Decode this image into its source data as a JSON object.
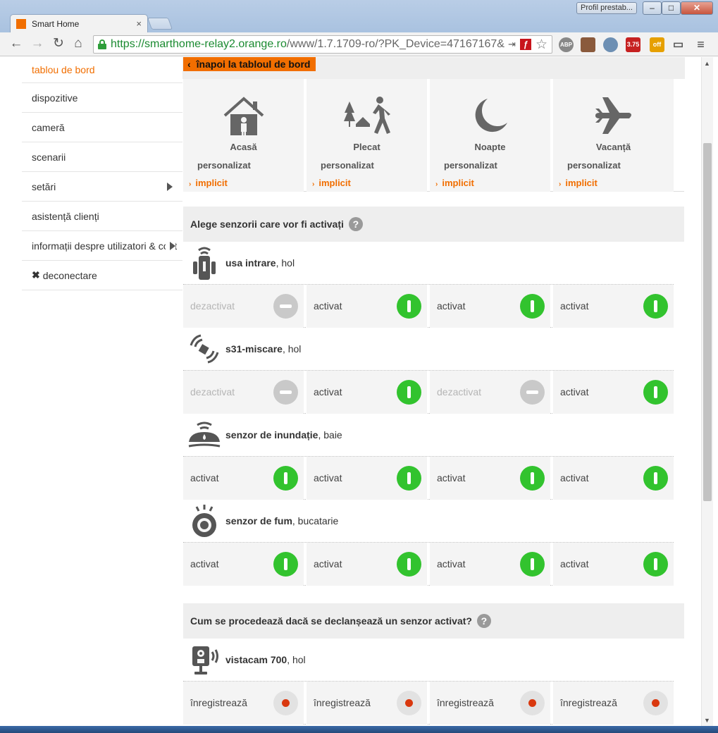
{
  "browser": {
    "tab_title": "Smart Home",
    "tab_close": "×",
    "profile_label": "Profil prestab...",
    "url_scheme_host": "https://smarthome-relay2.orange.ro",
    "url_rest": "/www/1.7.1709-ro/?PK_Device=47167167&",
    "ext_badge_a": "ABP",
    "ext_badge_b": "3.75",
    "ext_badge_c": "off"
  },
  "sidebar": {
    "items": [
      {
        "label": "tablou de bord"
      },
      {
        "label": "dispozitive"
      },
      {
        "label": "cameră"
      },
      {
        "label": "scenarii"
      },
      {
        "label": "setări"
      },
      {
        "label": "asistență clienți"
      },
      {
        "label": "informații despre utilizatori & cont"
      },
      {
        "label": "deconectare"
      }
    ]
  },
  "main": {
    "back_label": "înapoi la tabloul de bord",
    "modes": [
      {
        "name": "Acasă",
        "custom": "personalizat",
        "default": "implicit"
      },
      {
        "name": "Plecat",
        "custom": "personalizat",
        "default": "implicit"
      },
      {
        "name": "Noapte",
        "custom": "personalizat",
        "default": "implicit"
      },
      {
        "name": "Vacanță",
        "custom": "personalizat",
        "default": "implicit"
      }
    ],
    "sensors_heading": "Alege senzorii care vor fi activați",
    "help_glyph": "?",
    "sensors": [
      {
        "name": "usa intrare",
        "room": ", hol",
        "states": [
          "dezactivat",
          "activat",
          "activat",
          "activat"
        ]
      },
      {
        "name": "s31-miscare",
        "room": ", hol",
        "states": [
          "dezactivat",
          "activat",
          "dezactivat",
          "activat"
        ]
      },
      {
        "name": "senzor de inundație",
        "room": ", baie",
        "states": [
          "activat",
          "activat",
          "activat",
          "activat"
        ]
      },
      {
        "name": "senzor de fum",
        "room": ", bucatarie",
        "states": [
          "activat",
          "activat",
          "activat",
          "activat"
        ]
      }
    ],
    "trigger_heading": "Cum se procedează dacă se declanșează un senzor activat?",
    "camera": {
      "name": "vistacam 700",
      "room": ", hol",
      "actions": [
        "înregistrează",
        "înregistrează",
        "înregistrează",
        "înregistrează"
      ]
    }
  },
  "colors": {
    "accent": "#f16e00",
    "toggle_on": "#32c32e",
    "toggle_off": "#c9c9c9",
    "record": "#d9380e"
  }
}
